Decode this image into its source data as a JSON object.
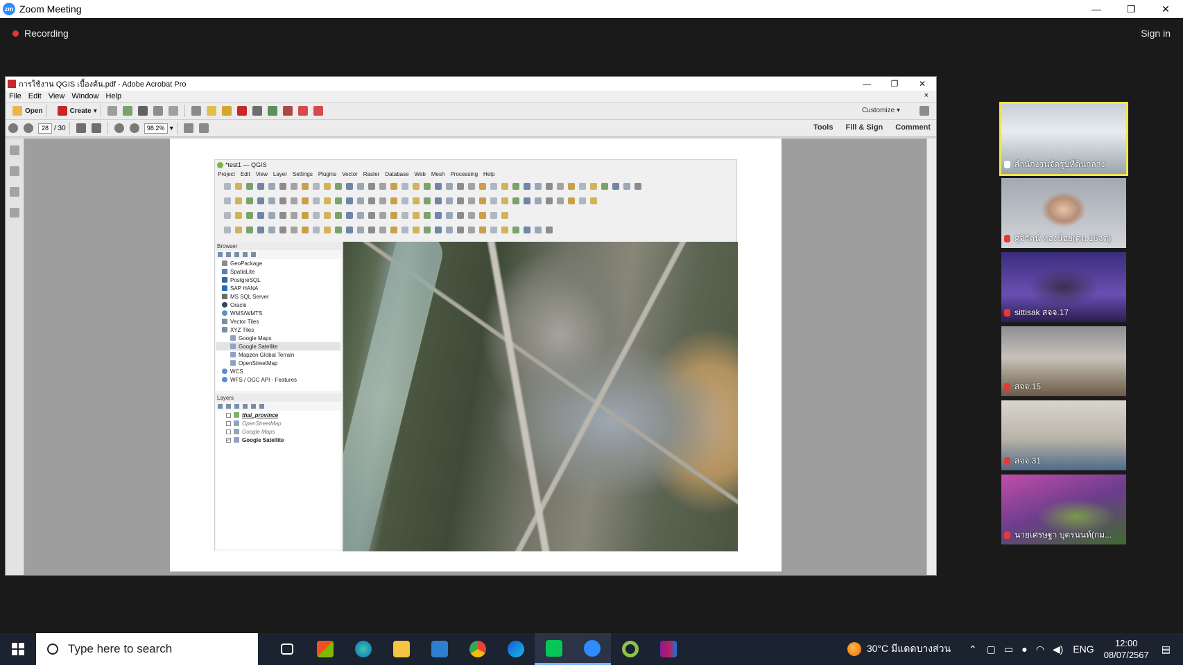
{
  "zoom": {
    "window_title": "Zoom Meeting",
    "logo_text": "zm",
    "recording_label": "Recording",
    "sign_in_label": "Sign in",
    "controls": {
      "minimize": "—",
      "restore": "❐",
      "close": "✕"
    }
  },
  "acrobat": {
    "title": "การใช้งาน QGIS เบื้องต้น.pdf - Adobe Acrobat Pro",
    "menu": [
      "File",
      "Edit",
      "View",
      "Window",
      "Help"
    ],
    "toolbar": {
      "open_label": "Open",
      "create_label": "Create",
      "customize_label": "Customize"
    },
    "nav": {
      "current_page": "28",
      "total_pages": "/ 30",
      "zoom": "98.2%"
    },
    "right_tabs": [
      "Tools",
      "Fill & Sign",
      "Comment"
    ]
  },
  "qgis": {
    "title": "*test1 — QGIS",
    "menu": [
      "Project",
      "Edit",
      "View",
      "Layer",
      "Settings",
      "Plugins",
      "Vector",
      "Raster",
      "Database",
      "Web",
      "Mesh",
      "Processing",
      "Help"
    ],
    "browser_title": "Browser",
    "browser_items": [
      "GeoPackage",
      "SpatiaLite",
      "PostgreSQL",
      "SAP HANA",
      "MS SQL Server",
      "Oracle",
      "WMS/WMTS",
      "Vector Tiles",
      "XYZ Tiles",
      "Google Maps",
      "Google Satellite",
      "Mapzen Global Terrain",
      "OpenStreetMap",
      "WCS",
      "WFS / OGC API - Features"
    ],
    "layers_title": "Layers",
    "layers": [
      "thai_province",
      "OpenStreetMap",
      "Google Maps",
      "Google Satellite"
    ]
  },
  "participants": [
    {
      "name": "สำนักงานจัดรูปที่ดินกลาง",
      "muted": false
    },
    {
      "name": "ศุจิรัตน์ ทองน้อย(คม.16จด)",
      "muted": true
    },
    {
      "name": "sittisak สจจ.17",
      "muted": true
    },
    {
      "name": "สจจ.15",
      "muted": true
    },
    {
      "name": "สจจ.31",
      "muted": true
    },
    {
      "name": "นายเศรษฐา บุตรนนท์(กม...",
      "muted": true
    }
  ],
  "taskbar": {
    "search_placeholder": "Type here to search",
    "weather": "30°C มีแดดบางส่วน",
    "language": "ENG",
    "time": "12:00",
    "date": "08/07/2567"
  }
}
